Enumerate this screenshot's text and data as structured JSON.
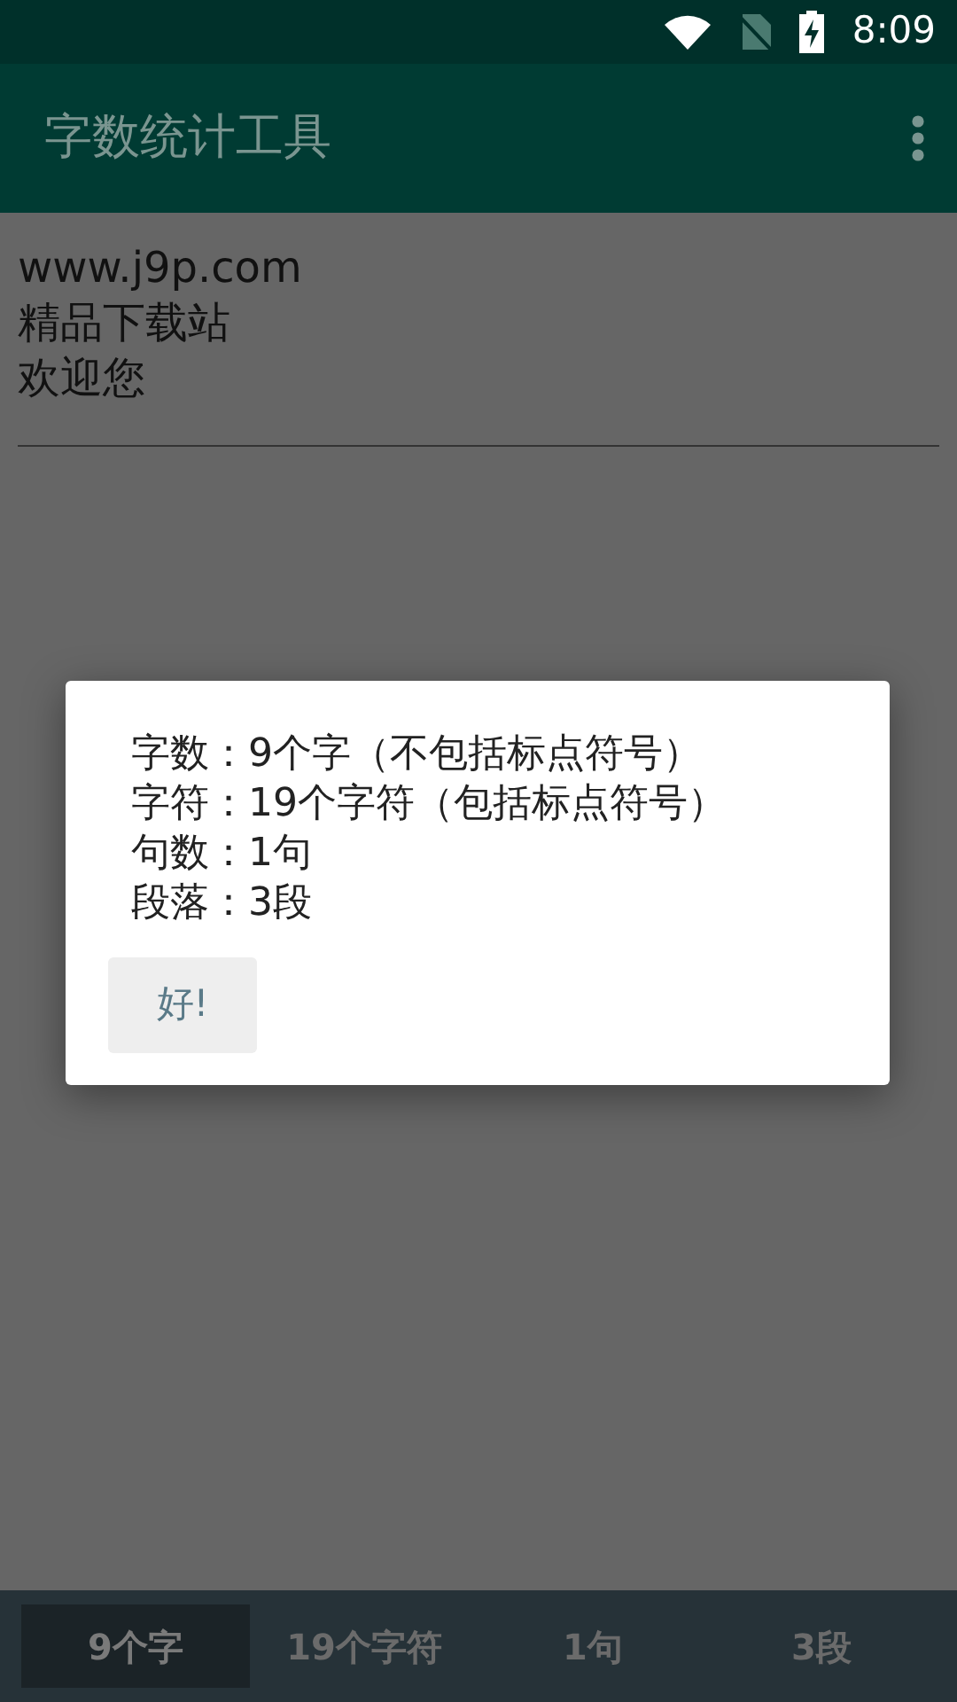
{
  "status_bar": {
    "time": "8:09"
  },
  "app_bar": {
    "title": "字数统计工具"
  },
  "editor": {
    "lines": [
      "www.j9p.com",
      "精品下载站",
      "欢迎您"
    ]
  },
  "dialog": {
    "lines": [
      "字数：9个字（不包括标点符号）",
      "字符：19个字符（包括标点符号）",
      "句数：1句",
      "段落：3段"
    ],
    "button": "好!"
  },
  "tabs": [
    {
      "label": "9个字",
      "selected": true
    },
    {
      "label": "19个字符",
      "selected": false
    },
    {
      "label": "1句",
      "selected": false
    },
    {
      "label": "3段",
      "selected": false
    }
  ]
}
